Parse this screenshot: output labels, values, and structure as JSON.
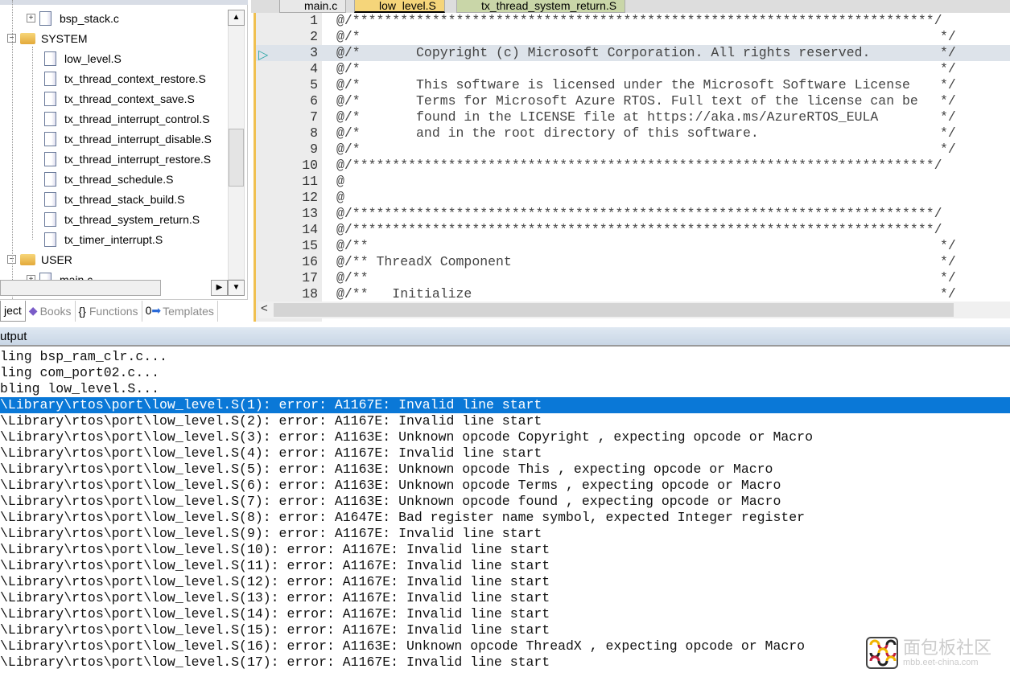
{
  "project_panel": {
    "tree": [
      {
        "label": "bsp_stack.c",
        "type": "file",
        "expander": "+",
        "level": 2
      },
      {
        "label": "SYSTEM",
        "type": "folder",
        "expander": "-",
        "level": 1
      },
      {
        "label": "low_level.S",
        "type": "file",
        "level": 2
      },
      {
        "label": "tx_thread_context_restore.S",
        "type": "file",
        "level": 2
      },
      {
        "label": "tx_thread_context_save.S",
        "type": "file",
        "level": 2
      },
      {
        "label": "tx_thread_interrupt_control.S",
        "type": "file",
        "level": 2
      },
      {
        "label": "tx_thread_interrupt_disable.S",
        "type": "file",
        "level": 2
      },
      {
        "label": "tx_thread_interrupt_restore.S",
        "type": "file",
        "level": 2
      },
      {
        "label": "tx_thread_schedule.S",
        "type": "file",
        "level": 2
      },
      {
        "label": "tx_thread_stack_build.S",
        "type": "file",
        "level": 2
      },
      {
        "label": "tx_thread_system_return.S",
        "type": "file",
        "level": 2
      },
      {
        "label": "tx_timer_interrupt.S",
        "type": "file",
        "level": 2
      },
      {
        "label": "USER",
        "type": "folder",
        "expander": "-",
        "level": 1
      },
      {
        "label": "main.c",
        "type": "file",
        "expander": "+",
        "level": 2
      }
    ],
    "tabs": [
      {
        "label": "ject",
        "icon": "project-icon",
        "active": true
      },
      {
        "label": "Books",
        "icon": "books-icon"
      },
      {
        "label": "Functions",
        "icon": "functions-icon"
      },
      {
        "label": "Templates",
        "icon": "templates-icon"
      }
    ]
  },
  "editor": {
    "tabs": [
      {
        "label": "main.c"
      },
      {
        "label": "low_level.S",
        "active": true
      },
      {
        "label": "tx_thread_system_return.S"
      }
    ],
    "current_line": 3,
    "lines": [
      {
        "n": "1",
        "text": "@/*************************************************************************/"
      },
      {
        "n": "2",
        "text": "@/*",
        "end": "*/"
      },
      {
        "n": "3",
        "text": "@/*       Copyright (c) Microsoft Corporation. All rights reserved.",
        "end": "*/"
      },
      {
        "n": "4",
        "text": "@/*",
        "end": "*/"
      },
      {
        "n": "5",
        "text": "@/*       This software is licensed under the Microsoft Software License",
        "end": "*/"
      },
      {
        "n": "6",
        "text": "@/*       Terms for Microsoft Azure RTOS. Full text of the license can be",
        "end": "*/"
      },
      {
        "n": "7",
        "text": "@/*       found in the LICENSE file at https://aka.ms/AzureRTOS_EULA",
        "end": "*/"
      },
      {
        "n": "8",
        "text": "@/*       and in the root directory of this software.",
        "end": "*/"
      },
      {
        "n": "9",
        "text": "@/*",
        "end": "*/"
      },
      {
        "n": "10",
        "text": "@/*************************************************************************/"
      },
      {
        "n": "11",
        "text": "@"
      },
      {
        "n": "12",
        "text": "@"
      },
      {
        "n": "13",
        "text": "@/*************************************************************************/"
      },
      {
        "n": "14",
        "text": "@/*************************************************************************/"
      },
      {
        "n": "15",
        "text": "@/**",
        "end": "*/"
      },
      {
        "n": "16",
        "text": "@/** ThreadX Component",
        "end": "*/"
      },
      {
        "n": "17",
        "text": "@/**",
        "end": "*/"
      },
      {
        "n": "18",
        "text": "@/**   Initialize",
        "end": "*/"
      }
    ]
  },
  "output": {
    "title": "utput",
    "selected_index": 3,
    "lines": [
      "ling bsp_ram_clr.c...",
      "ling com_port02.c...",
      "bling low_level.S...",
      "\\Library\\rtos\\port\\low_level.S(1): error: A1167E: Invalid line start",
      "\\Library\\rtos\\port\\low_level.S(2): error: A1167E: Invalid line start",
      "\\Library\\rtos\\port\\low_level.S(3): error: A1163E: Unknown opcode Copyright , expecting opcode or Macro",
      "\\Library\\rtos\\port\\low_level.S(4): error: A1167E: Invalid line start",
      "\\Library\\rtos\\port\\low_level.S(5): error: A1163E: Unknown opcode This , expecting opcode or Macro",
      "\\Library\\rtos\\port\\low_level.S(6): error: A1163E: Unknown opcode Terms , expecting opcode or Macro",
      "\\Library\\rtos\\port\\low_level.S(7): error: A1163E: Unknown opcode found , expecting opcode or Macro",
      "\\Library\\rtos\\port\\low_level.S(8): error: A1647E: Bad register name symbol, expected Integer register",
      "\\Library\\rtos\\port\\low_level.S(9): error: A1167E: Invalid line start",
      "\\Library\\rtos\\port\\low_level.S(10): error: A1167E: Invalid line start",
      "\\Library\\rtos\\port\\low_level.S(11): error: A1167E: Invalid line start",
      "\\Library\\rtos\\port\\low_level.S(12): error: A1167E: Invalid line start",
      "\\Library\\rtos\\port\\low_level.S(13): error: A1167E: Invalid line start",
      "\\Library\\rtos\\port\\low_level.S(14): error: A1167E: Invalid line start",
      "\\Library\\rtos\\port\\low_level.S(15): error: A1167E: Invalid line start",
      "\\Library\\rtos\\port\\low_level.S(16): error: A1163E: Unknown opcode ThreadX , expecting opcode or Macro",
      "\\Library\\rtos\\port\\low_level.S(17): error: A1167E: Invalid line start"
    ]
  },
  "watermark": {
    "text": "面包板社区",
    "sub": "mbb.eet-china.com"
  },
  "colors": {
    "selection": "#0a78d7",
    "current_line": "#dde3ea",
    "active_tab": "#f5d57a"
  }
}
